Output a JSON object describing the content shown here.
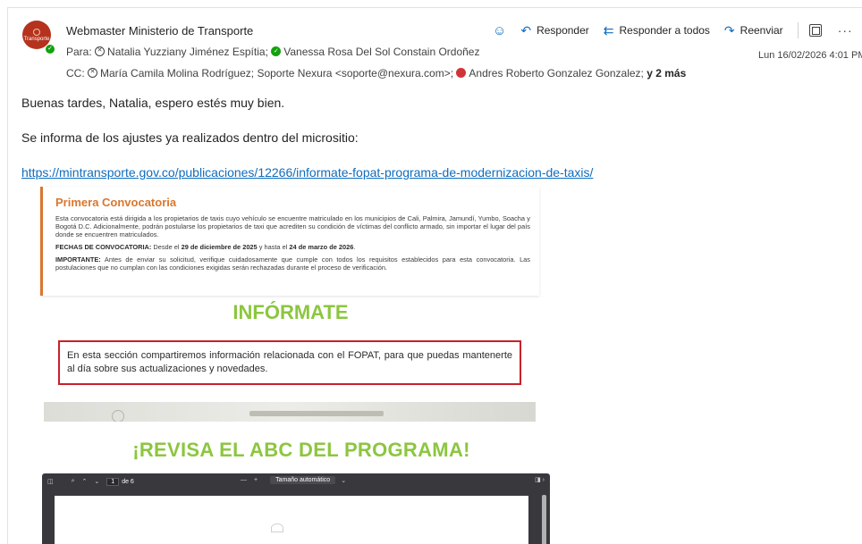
{
  "email": {
    "sender": "Webmaster Ministerio de Transporte",
    "avatar_text": "Transporte",
    "to_label": "Para:",
    "to": [
      "Natalia Yuzziany Jiménez Espítia;",
      "Vanessa Rosa Del Sol Constain Ordoñez"
    ],
    "cc_label": "CC:",
    "cc": [
      "María Camila Molina Rodríguez;",
      "Soporte Nexura <soporte@nexura.com>;",
      "Andres Roberto Gonzalez Gonzalez;"
    ],
    "cc_more": "y 2 más",
    "date": "Lun 16/02/2026 4:01 PM",
    "actions": {
      "emoji_icon": "smile-icon",
      "reply": "Responder",
      "reply_all": "Responder a todos",
      "forward": "Reenviar",
      "more": "···"
    }
  },
  "body": {
    "greeting": "Buenas tardes, Natalia, espero estés muy bien.",
    "intro": "Se informa de los ajustes ya realizados dentro del micrositio:",
    "link": "https://mintransporte.gov.co/publicaciones/12266/informate-fopat-programa-de-modernizacion-de-taxis/"
  },
  "embedded": {
    "card_title": "Primera Convocatoria",
    "card_p1": "Esta convocatoria está dirigida a los propietarios de taxis cuyo vehículo se encuentre matriculado en los municipios de Cali, Palmira, Jamundí, Yumbo, Soacha y Bogotá D.C. Adicionalmente, podrán postularse los propietarios de taxi que acrediten su condición de víctimas del conflicto armado, sin importar el lugar del país donde se encuentren matriculados.",
    "card_p2_label": "FECHAS DE CONVOCATORIA:",
    "card_p2_a": "Desde el",
    "card_p2_d1": "29 de diciembre de 2025",
    "card_p2_b": "y hasta el",
    "card_p2_d2": "24 de marzo de 2026",
    "card_p3_label": "IMPORTANTE:",
    "card_p3": "Antes de enviar su solicitud, verifique cuidadosamente que cumple con todos los requisitos establecidos para esta convocatoria. Las postulaciones que no cumplan con las condiciones exigidas serán rechazadas durante el proceso de verificación.",
    "informate": "INFÓRMATE",
    "box_text": "En esta sección compartiremos información relacionada con el FOPAT, para que puedas mantenerte al día sobre sus actualizaciones y novedades.",
    "revisa": "¡REVISA EL ABC DEL PROGRAMA!"
  },
  "pdf": {
    "page": "1",
    "of": "de 6",
    "zoom": "Tamaño automático"
  },
  "colors": {
    "accent": "#0f6cbd",
    "orange": "#d9772f",
    "green": "#8cc63f",
    "red_box": "#c8212b"
  }
}
